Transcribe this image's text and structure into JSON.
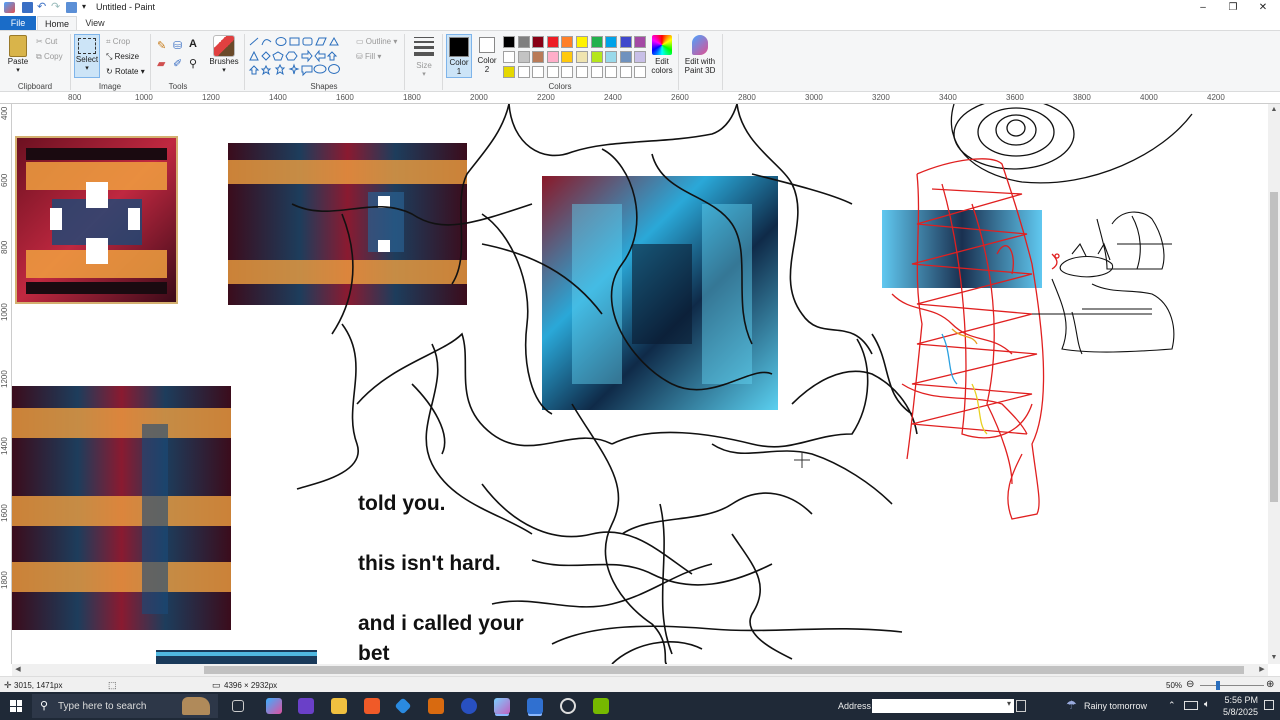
{
  "app": {
    "title": "Untitled - Paint",
    "tabs": [
      "File",
      "Home",
      "View"
    ],
    "window_controls": [
      "–",
      "❐",
      "✕"
    ]
  },
  "ribbon": {
    "clipboard": {
      "paste": "Paste",
      "cut": "Cut",
      "copy": "Copy",
      "label": "Clipboard"
    },
    "image": {
      "select": "Select",
      "crop": "Crop",
      "resize": "Resize",
      "rotate": "Rotate",
      "label": "Image"
    },
    "tools": {
      "label": "Tools"
    },
    "brushes": {
      "label": "Brushes"
    },
    "shapes": {
      "outline": "Outline",
      "fill": "Fill",
      "label": "Shapes"
    },
    "size": {
      "label": "Size"
    },
    "color1": {
      "label1": "Color",
      "label2": "1"
    },
    "color2": {
      "label1": "Color",
      "label2": "2"
    },
    "colors": {
      "label": "Colors"
    },
    "edit_colors": {
      "line1": "Edit",
      "line2": "colors"
    },
    "paint3d": {
      "line1": "Edit with",
      "line2": "Paint 3D"
    },
    "palette_row1": [
      "#000000",
      "#7f7f7f",
      "#880015",
      "#ed1c24",
      "#ff7f27",
      "#fff200",
      "#22b14c",
      "#00a2e8",
      "#3f48cc",
      "#a349a4"
    ],
    "palette_row2": [
      "#ffffff",
      "#c3c3c3",
      "#b97a57",
      "#ffaec9",
      "#ffc90e",
      "#efe4b0",
      "#b5e61d",
      "#99d9ea",
      "#7092be",
      "#c8bfe7"
    ],
    "palette_row3": [
      "#e5d800",
      "#ffffff",
      "#ffffff",
      "#ffffff",
      "#ffffff",
      "#ffffff",
      "#ffffff",
      "#ffffff",
      "#ffffff",
      "#ffffff"
    ]
  },
  "ruler": {
    "top": [
      "800",
      "1000",
      "1200",
      "1400",
      "1600",
      "1800",
      "2000",
      "2200",
      "2400",
      "2600",
      "2800",
      "3000",
      "3200",
      "3400",
      "3600",
      "3800",
      "4000",
      "4200"
    ],
    "left": [
      "400",
      "600",
      "800",
      "1000",
      "1200",
      "1400",
      "1600",
      "1800"
    ]
  },
  "canvas": {
    "text1": "told you.",
    "text2": "this isn't hard.",
    "text3": "and i called your",
    "text4": "bet"
  },
  "status": {
    "cursor_pos": "3015, 1471px",
    "selection_size": "",
    "image_size": "4396 × 2932px",
    "zoom": "50%",
    "zoom_fraction": 0.5
  },
  "taskbar": {
    "search_placeholder": "Type here to search",
    "address_label": "Address",
    "weather": "Rainy tomorrow",
    "time": "5:56 PM",
    "date": "5/8/2025"
  }
}
